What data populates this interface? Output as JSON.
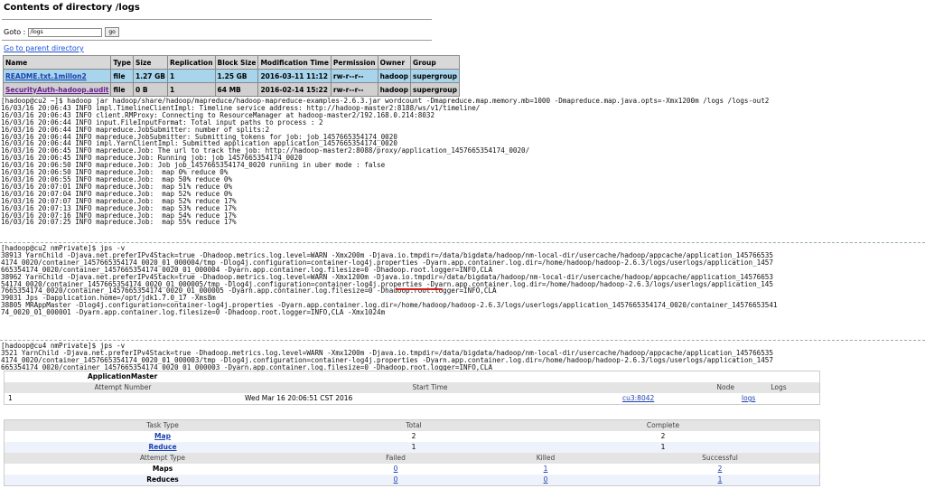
{
  "directory": {
    "title": "Contents of directory /logs",
    "goto_label": "Goto :",
    "goto_value": "/logs",
    "goto_button": "go",
    "parent_link": "Go to parent directory",
    "columns": [
      "Name",
      "Type",
      "Size",
      "Replication",
      "Block Size",
      "Modification Time",
      "Permission",
      "Owner",
      "Group"
    ],
    "rows": [
      [
        "README.txt.1millon2",
        "file",
        "1.27 GB",
        "1",
        "1.25 GB",
        "2016-03-11 11:12",
        "rw-r--r--",
        "hadoop",
        "supergroup"
      ],
      [
        "SecurityAuth-hadoop.audit",
        "file",
        "0 B",
        "1",
        "64 MB",
        "2016-02-14 15:22",
        "rw-r--r--",
        "hadoop",
        "supergroup"
      ]
    ]
  },
  "terminal": {
    "block1": "[hadoop@cu2 ~]$ hadoop jar hadoop/share/hadoop/mapreduce/hadoop-mapreduce-examples-2.6.3.jar wordcount -Dmapreduce.map.memory.mb=1000 -Dmapreduce.map.java.opts=-Xmx1200m /logs /logs-out2\n16/03/16 20:06:43 INFO impl.TimelineClientImpl: Timeline service address: http://hadoop-master2:8188/ws/v1/timeline/\n16/03/16 20:06:43 INFO client.RMProxy: Connecting to ResourceManager at hadoop-master2/192.168.0.214:8032\n16/03/16 20:06:44 INFO input.FileInputFormat: Total input paths to process : 2\n16/03/16 20:06:44 INFO mapreduce.JobSubmitter: number of splits:2\n16/03/16 20:06:44 INFO mapreduce.JobSubmitter: Submitting tokens for job: job_1457665354174_0020\n16/03/16 20:06:44 INFO impl.YarnClientImpl: Submitted application application_1457665354174_0020\n16/03/16 20:06:45 INFO mapreduce.Job: The url to track the job: http://hadoop-master2:8088/proxy/application_1457665354174_0020/\n16/03/16 20:06:45 INFO mapreduce.Job: Running job: job_1457665354174_0020\n16/03/16 20:06:50 INFO mapreduce.Job: Job job_1457665354174_0020 running in uber mode : false\n16/03/16 20:06:50 INFO mapreduce.Job:  map 0% reduce 0%\n16/03/16 20:06:55 INFO mapreduce.Job:  map 50% reduce 0%\n16/03/16 20:07:01 INFO mapreduce.Job:  map 51% reduce 0%\n16/03/16 20:07:04 INFO mapreduce.Job:  map 52% reduce 0%\n16/03/16 20:07:07 INFO mapreduce.Job:  map 52% reduce 17%\n16/03/16 20:07:13 INFO mapreduce.Job:  map 53% reduce 17%\n16/03/16 20:07:16 INFO mapreduce.Job:  map 54% reduce 17%\n16/03/16 20:07:25 INFO mapreduce.Job:  map 55% reduce 17%",
    "block2": "[hadoop@cu2 nmPrivate]$ jps -v\n38913 YarnChild -Djava.net.preferIPv4Stack=true -Dhadoop.metrics.log.level=WARN -Xmx200m -Djava.io.tmpdir=/data/bigdata/hadoop/nm-local-dir/usercache/hadoop/appcache/application_145766535\n4174_0020/container_1457665354174_0020_01_000004/tmp -Dlog4j.configuration=container-log4j.properties -Dyarn.app.container.log.dir=/home/hadoop/hadoop-2.6.3/logs/userlogs/application_1457\n665354174_0020/container_1457665354174_0020_01_000004 -Dyarn.app.container.log.filesize=0 -Dhadoop.root.logger=INFO,CLA\n38962 YarnChild -Djava.net.preferIPv4Stack=true -Dhadoop.metrics.log.level=WARN -Xmx1200m -Djava.io.tmpdir=/data/bigdata/hadoop/nm-local-dir/usercache/hadoop/appcache/application_14576653\n54174_0020/container_1457665354174_0020_01_000005/tmp -Dlog4j.configuration=container-log4j.properties -Dyarn.app.container.log.dir=/home/hadoop/hadoop-2.6.3/logs/userlogs/application_145\n7665354174_0020/container_1457665354174_0020_01_000005 -Dyarn.app.container.log.filesize=0 -Dhadoop.root.logger=INFO,CLA\n39031 Jps -Dapplication.home=/opt/jdk1.7.0_17 -Xms8m\n38805 MRAppMaster -Dlog4j.configuration=container-log4j.properties -Dyarn.app.container.log.dir=/home/hadoop/hadoop-2.6.3/logs/userlogs/application_1457665354174_0020/container_14576653541\n74_0020_01_000001 -Dyarn.app.container.log.filesize=0 -Dhadoop.root.logger=INFO,CLA -Xmx1024m",
    "block3": "[hadoop@cu4 nmPrivate]$ jps -v\n3521 YarnChild -Djava.net.preferIPv4Stack=true -Dhadoop.metrics.log.level=WARN -Xmx1200m -Djava.io.tmpdir=/data/bigdata/hadoop/nm-local-dir/usercache/hadoop/appcache/application_145766535\n4174_0020/container_1457665354174_0020_01_000003/tmp -Dlog4j.configuration=container-log4j.properties -Dyarn.app.container.log.dir=/home/hadoop/hadoop-2.6.3/logs/userlogs/application_1457\n665354174_0020/container_1457665354174_0020_01_000003 -Dyarn.app.container.log.filesize=0 -Dhadoop.root.logger=INFO,CLA"
  },
  "app_master": {
    "title": "ApplicationMaster",
    "headers": [
      "Attempt Number",
      "Start Time",
      "Node",
      "Logs"
    ],
    "row": [
      "1",
      "Wed Mar 16 20:06:51 CST 2016",
      "cu3:8042",
      "logs"
    ]
  },
  "tasks": {
    "headers": [
      "Task Type",
      "Total",
      "Complete"
    ],
    "rows": [
      [
        "Map",
        "2",
        "2"
      ],
      [
        "Reduce",
        "1",
        "1"
      ]
    ],
    "attempt_headers": [
      "Attempt Type",
      "Failed",
      "Killed",
      "Successful"
    ],
    "attempt_rows": [
      [
        "Maps",
        "0",
        "1",
        "2"
      ],
      [
        "Reduces",
        "0",
        "0",
        "1"
      ]
    ]
  },
  "colors": {
    "link": "#1a3fb0",
    "row_highlight": "#a8d4ec",
    "annotation": "#d42020"
  }
}
